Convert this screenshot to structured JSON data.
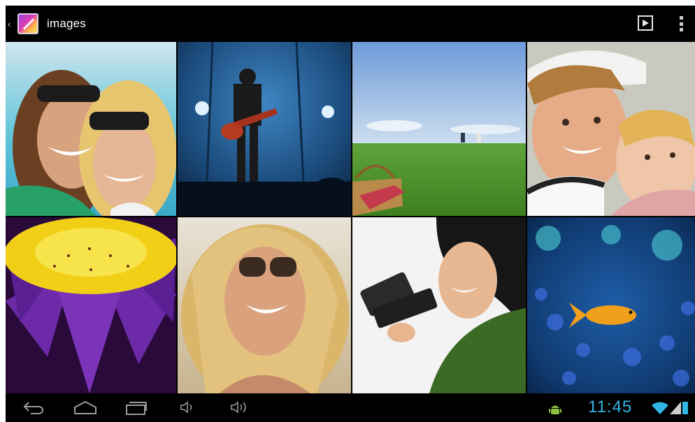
{
  "action_bar": {
    "title": "images",
    "icons": {
      "up": "chevron-left-icon",
      "app": "gallery-app-icon",
      "slideshow": "slideshow-play-icon",
      "overflow": "overflow-menu-icon"
    }
  },
  "grid": {
    "thumbnails": [
      {
        "name": "two-women-sunglasses-beach"
      },
      {
        "name": "guitarist-on-stage"
      },
      {
        "name": "picnic-basket-field"
      },
      {
        "name": "two-smiling-children"
      },
      {
        "name": "purple-yellow-flower-macro"
      },
      {
        "name": "blonde-woman-sunglasses"
      },
      {
        "name": "woman-with-smartphone"
      },
      {
        "name": "orange-fish-blue-bokeh"
      }
    ]
  },
  "nav_bar": {
    "icons": {
      "back": "back-icon",
      "home": "home-icon",
      "recent_apps": "recent-apps-icon",
      "volume_down": "volume-down-icon",
      "volume_up": "volume-up-icon",
      "android_debug": "android-icon",
      "wifi": "wifi-icon",
      "signal": "cell-signal-icon",
      "battery": "battery-icon"
    },
    "clock": "11:45"
  },
  "colors": {
    "accent": "#33b5e5",
    "bar_bg": "#000000",
    "icon_gray": "#cccccc"
  }
}
